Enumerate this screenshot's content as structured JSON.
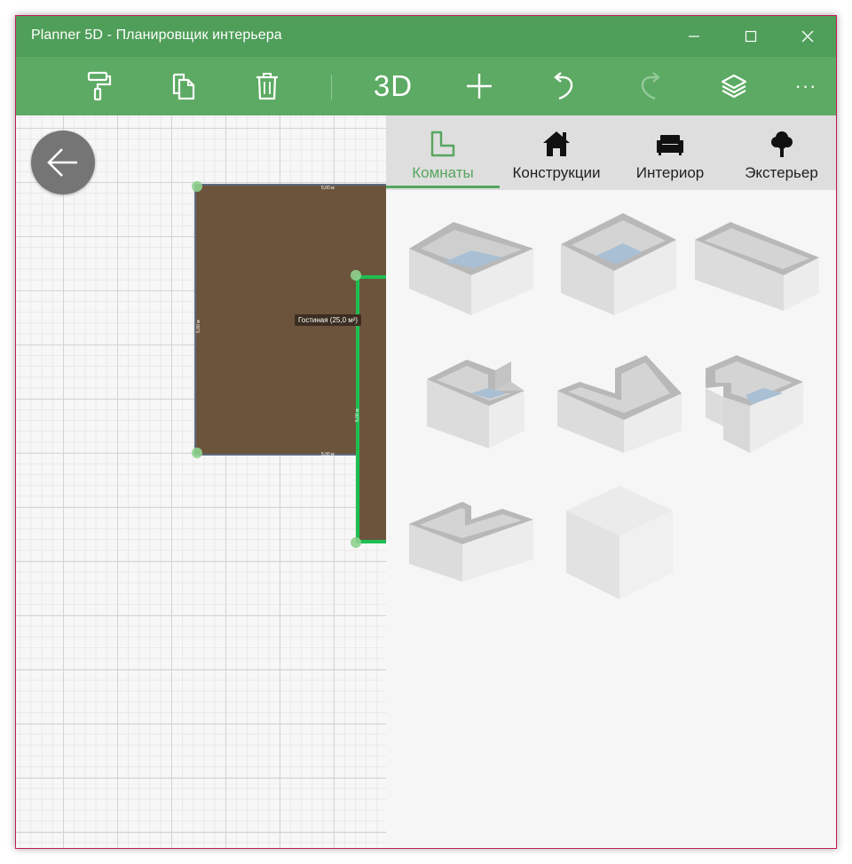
{
  "window": {
    "title": "Planner 5D - Планировщик интерьера",
    "minimize_icon": "minimize-icon",
    "maximize_icon": "maximize-icon",
    "close_icon": "close-icon"
  },
  "toolbar": {
    "paint_icon": "paint-roller-icon",
    "copy_icon": "copy-icon",
    "delete_icon": "trash-icon",
    "view3d_label": "3D",
    "add_icon": "plus-icon",
    "undo_icon": "undo-icon",
    "redo_icon": "redo-icon",
    "layers_icon": "layers-icon",
    "more_label": "···"
  },
  "canvas": {
    "back_icon": "arrow-left-icon",
    "room_label": "Гостиная (25,0 м²)",
    "dim_top": "5,00 м",
    "dim_bottom": "5,00 м",
    "dim_left": "5,00 м",
    "dim_right": "5,00 м"
  },
  "panel": {
    "tabs": [
      {
        "label": "Комнаты",
        "icon": "room-shape-icon",
        "active": true
      },
      {
        "label": "Конструкции",
        "icon": "house-icon",
        "active": false
      },
      {
        "label": "Интериор",
        "icon": "sofa-icon",
        "active": false
      },
      {
        "label": "Экстерьер",
        "icon": "tree-icon",
        "active": false
      }
    ],
    "room_shapes": [
      "rectangular-room-open",
      "rectangular-room-deep",
      "rectangular-room-wide",
      "l-shaped-room-notch",
      "l-shaped-room-corner",
      "l-shaped-room-cutout",
      "l-shaped-room-low",
      "solid-box"
    ],
    "accent_color": "#56a65f"
  },
  "colors": {
    "titlebar": "#4f9e59",
    "toolbar": "#5caa63",
    "room_fill": "#6b543b",
    "selected_wall": "#1ebe52"
  }
}
